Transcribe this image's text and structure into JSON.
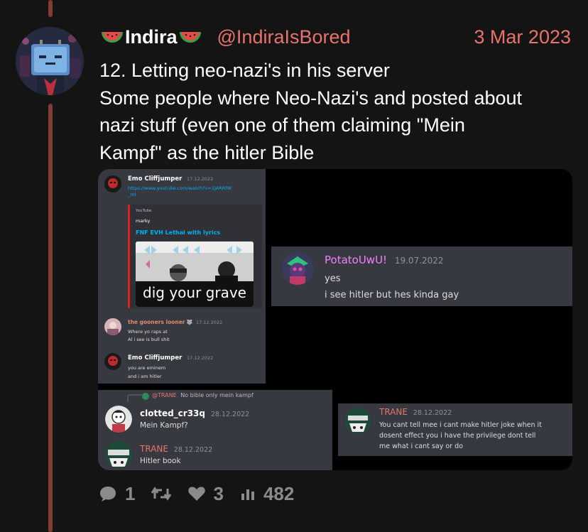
{
  "tweet": {
    "display_name": "Indira",
    "name_emoji": "watermelon-emoji",
    "handle": "@IndiraIsBored",
    "date": "3 Mar 2023",
    "lines": [
      "12. Letting neo-nazi's in his server",
      "Some people where Neo-Nazi's and posted about",
      "nazi stuff (even one of them claiming \"Mein",
      "Kampf\" as the hitler Bible"
    ]
  },
  "colors": {
    "background": "#141414",
    "accent": "#e8736b",
    "thread_line": "#803c35",
    "discord_bg": "#36393f",
    "discord_link": "#00b0f4"
  },
  "discord_top_left": {
    "m1": {
      "user": "Emo Cliffjumper",
      "time": "17.12.2022",
      "link_1": "https://www.youtube.com/watch?v=1JARRfW",
      "link_2": "_ml"
    },
    "embed": {
      "provider": "YouTube",
      "author": "marky",
      "title": "FNF EVH Lethal with lyrics",
      "caption": "dig your grave"
    },
    "m2": {
      "user": "the gooners looner",
      "time": "17.12.2022",
      "line_1": "Where yo raps at",
      "line_2": "Al i see is bull shit"
    },
    "m3": {
      "user": "Emo Cliffjumper",
      "time": "17.12.2022",
      "line_1": "you are eminem",
      "line_2": "and i am hitler"
    }
  },
  "discord_potato": {
    "user": "PotatoUwU!",
    "time": "19.07.2022",
    "line_1": "yes",
    "line_2": "i see hitler but hes kinda gay"
  },
  "discord_bottom_left": {
    "reply_user": "@TRANE",
    "reply_text": "No bible only mein kampf",
    "m1": {
      "user": "clotted_cr33q",
      "time": "28.12.2022",
      "text": "Mein Kampf?"
    },
    "m2": {
      "user": "TRANE",
      "time": "28.12.2022",
      "text": "Hitler book"
    }
  },
  "discord_trane": {
    "user": "TRANE",
    "time": "28.12.2022",
    "line_1": "You cant tell mee i cant make hitler joke when it",
    "line_2": "dosent effect you i have the privilege dont tell",
    "line_3": "me what i cant say or do"
  },
  "stats": {
    "replies": "1",
    "likes": "3",
    "views": "482"
  }
}
